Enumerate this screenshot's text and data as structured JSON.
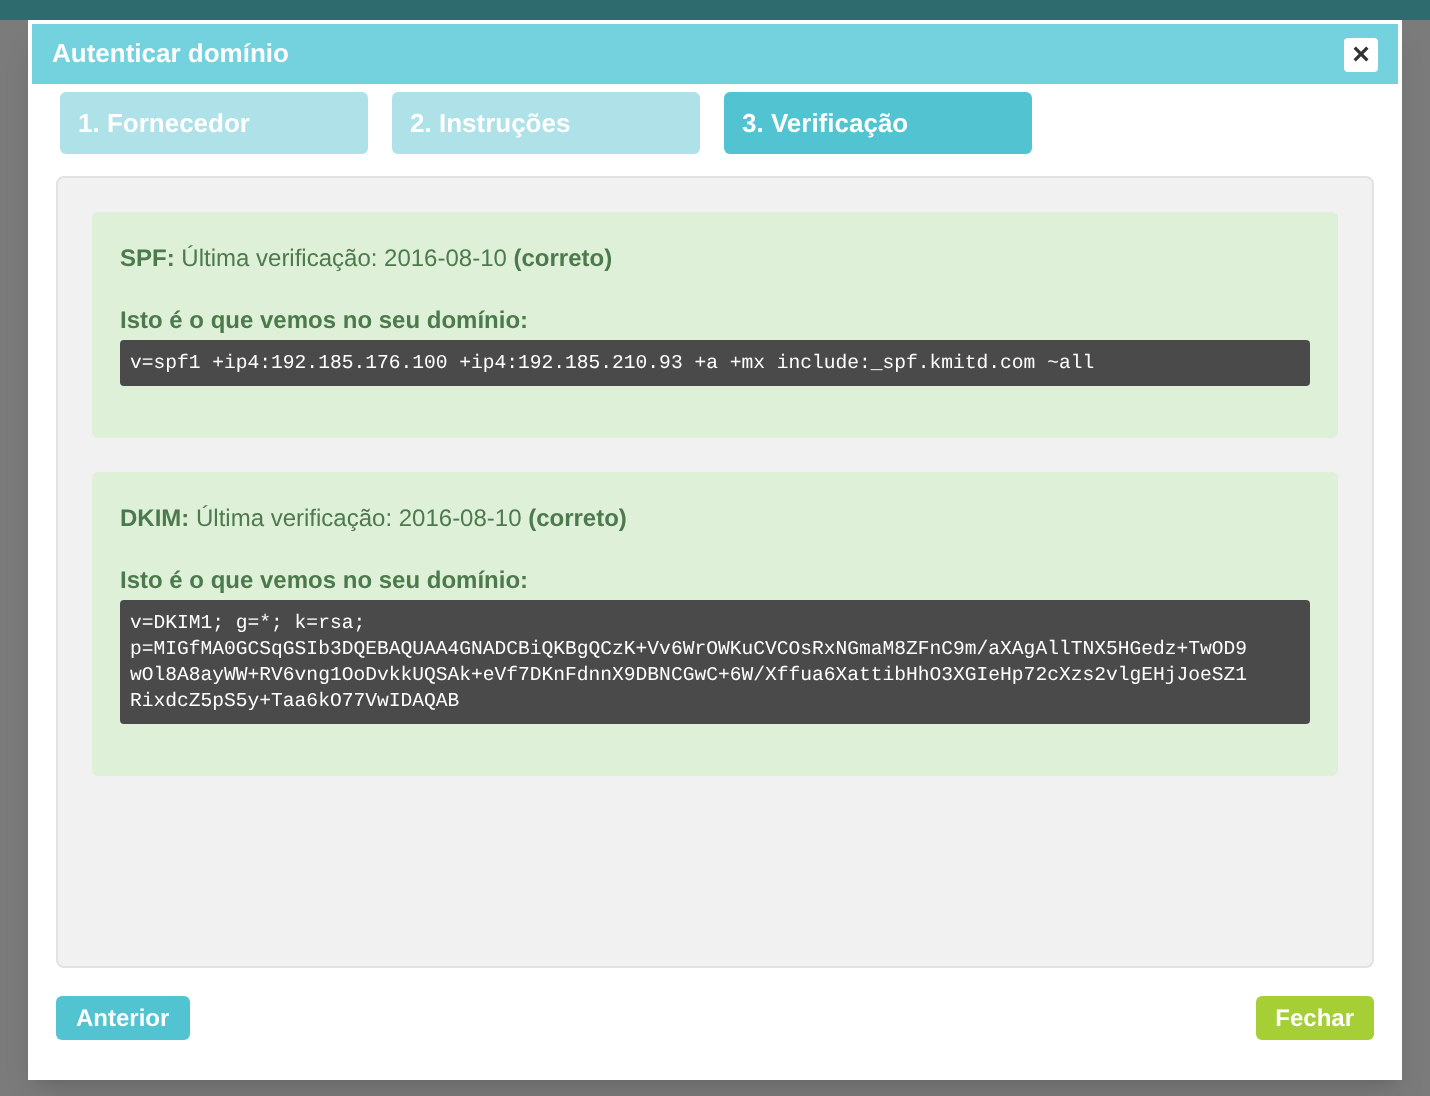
{
  "dialog": {
    "title": "Autenticar domínio",
    "close": "×"
  },
  "tabs": [
    {
      "label": "1. Fornecedor",
      "selected": false
    },
    {
      "label": "2. Instruções",
      "selected": false
    },
    {
      "label": "3. Verificação",
      "selected": true
    }
  ],
  "records": [
    {
      "title": "**SPF:** Última verificação: 2016-08-10 **(correto)**",
      "label": "Isto é o que vemos no seu domínio:",
      "lines": [
        "v=spf1 +ip4:192.185.176.100 +ip4:192.185.210.93 +a +mx include:_spf.kmitd.com ~all"
      ]
    },
    {
      "title": "**DKIM:** Última verificação: 2016-08-10 **(correto)**",
      "label": "Isto é o que vemos no seu domínio:",
      "lines": [
        "v=DKIM1; g=*; k=rsa;",
        "p=MIGfMA0GCSqGSIb3DQEBAQUAA4GNADCBiQKBgQCzK+Vv6WrOWKuCVCOsRxNGmaM8ZFnC9m/aXAgAllTNX5HGedz+TwOD9",
        "wOl8A8ayWW+RV6vng1OoDvkkUQSAk+eVf7DKnFdnnX9DBNCGwC+6W/Xffua6XattibHhO3XGIeHp72cXzs2vlgEHjJoeSZ1",
        "RixdcZ5pS5y+Taa6kO77VwIDAQAB"
      ]
    }
  ],
  "buttons": {
    "previous": "Anterior",
    "close": "Fechar"
  }
}
